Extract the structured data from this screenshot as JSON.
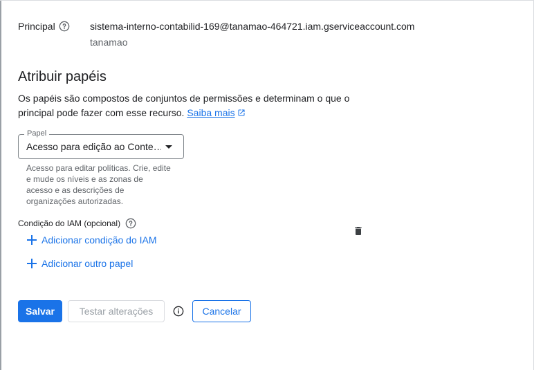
{
  "principal": {
    "label": "Principal",
    "email": "sistema-interno-contabilid-169@tanamao-464721.iam.gserviceaccount.com",
    "project": "tanamao"
  },
  "assign_roles": {
    "title": "Atribuir papéis",
    "description": "Os papéis são compostos de conjuntos de permissões e determinam o que o principal pode fazer com esse recurso.",
    "learn_more": "Saiba mais"
  },
  "role": {
    "legend": "Papel",
    "value": "Acesso para edição ao Conte…",
    "help": "Acesso para editar políticas. Crie, edite e mude os níveis e as zonas de acesso e as descrições de organizações autorizadas."
  },
  "condition": {
    "label": "Condição do IAM (opcional)",
    "add_condition": "Adicionar condição do IAM"
  },
  "add_another_role": "Adicionar outro papel",
  "buttons": {
    "save": "Salvar",
    "test": "Testar alterações",
    "cancel": "Cancelar"
  },
  "icons": {
    "help": "help-circle-icon",
    "external": "open-in-new-icon",
    "delete": "trash-icon",
    "info": "info-icon",
    "add": "plus-icon"
  },
  "colors": {
    "accent": "#1a73e8",
    "text": "#202124",
    "muted": "#5f6368",
    "disabled": "#9aa0a6"
  }
}
